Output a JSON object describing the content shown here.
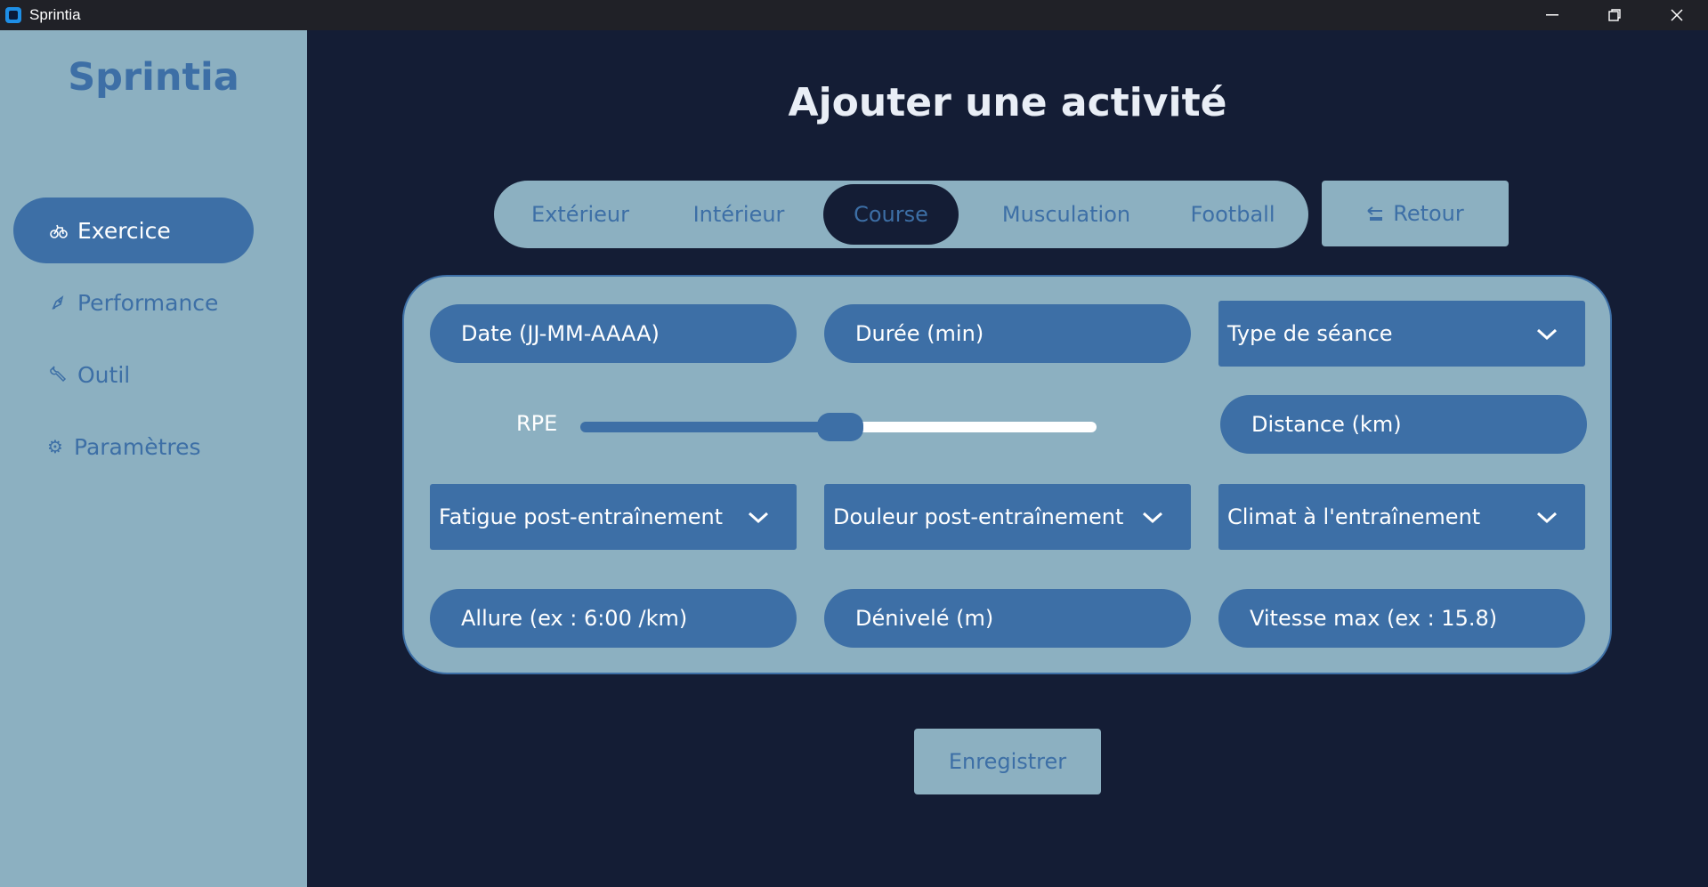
{
  "window": {
    "title": "Sprintia"
  },
  "sidebar": {
    "brand": "Sprintia",
    "items": [
      {
        "label": "Exercice",
        "icon": "bike-icon",
        "active": true
      },
      {
        "label": "Performance",
        "icon": "rocket-icon",
        "active": false
      },
      {
        "label": "Outil",
        "icon": "wrench-icon",
        "active": false
      },
      {
        "label": "Paramètres",
        "icon": "gear-icon",
        "active": false
      }
    ]
  },
  "main": {
    "title": "Ajouter une activité",
    "tabs": [
      {
        "label": "Extérieur",
        "active": false
      },
      {
        "label": "Intérieur",
        "active": false
      },
      {
        "label": "Course",
        "active": true
      },
      {
        "label": "Musculation",
        "active": false
      },
      {
        "label": "Football",
        "active": false
      }
    ],
    "back_label": "Retour",
    "form": {
      "date_placeholder": "Date (JJ-MM-AAAA)",
      "duration_placeholder": "Durée (min)",
      "session_type": "Type de séance",
      "rpe_label": "RPE",
      "rpe_value": 0.5,
      "distance_placeholder": "Distance (km)",
      "fatigue_select": "Fatigue post-entraînement",
      "pain_select": "Douleur post-entraînement",
      "climate_select": "Climat à l'entraînement",
      "pace_placeholder": "Allure (ex : 6:00 /km)",
      "elevation_placeholder": "Dénivelé (m)",
      "max_speed_placeholder": "Vitesse max (ex : 15.8)"
    },
    "save_label": "Enregistrer"
  },
  "colors": {
    "background": "#141d35",
    "panel": "#8cb0c1",
    "accent": "#3d6fa6"
  }
}
